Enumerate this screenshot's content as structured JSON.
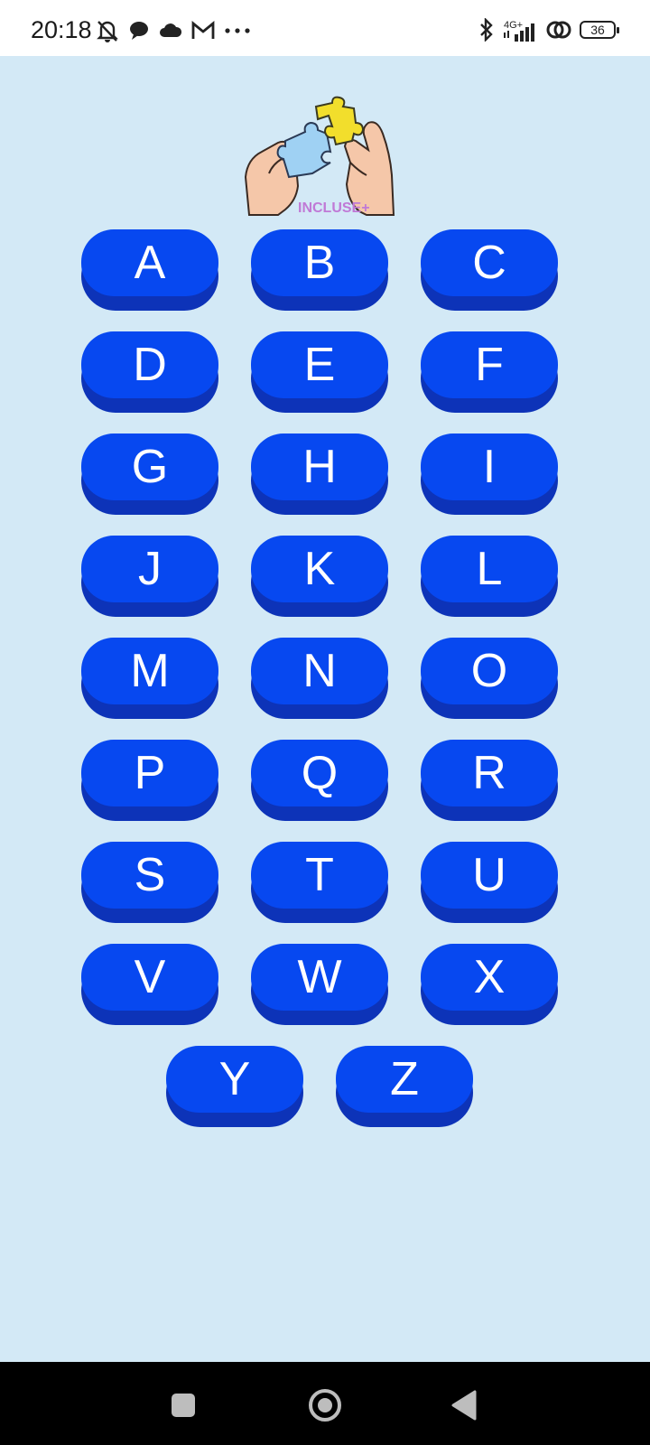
{
  "status_bar": {
    "time": "20:18",
    "left_icons": [
      "bell-off-icon",
      "chat-bubble-icon",
      "cloud-icon",
      "gmail-icon",
      "more-dots-icon"
    ],
    "network_label": "4G+",
    "battery_level": "36",
    "right_icons": [
      "bluetooth-icon",
      "signal-icon",
      "link-icon",
      "battery-icon"
    ]
  },
  "logo": {
    "text": "INCLUSE+",
    "icon": "puzzle-hands-icon"
  },
  "letters": [
    "A",
    "B",
    "C",
    "D",
    "E",
    "F",
    "G",
    "H",
    "I",
    "J",
    "K",
    "L",
    "M",
    "N",
    "O",
    "P",
    "Q",
    "R",
    "S",
    "T",
    "U",
    "V",
    "W",
    "X",
    "Y",
    "Z"
  ],
  "colors": {
    "background": "#d3e9f6",
    "button_face": "#0748f0",
    "button_shadow": "#0d33b8",
    "button_text": "#ffffff"
  },
  "nav_bar": {
    "buttons": [
      "recents-button",
      "home-button",
      "back-button"
    ]
  }
}
